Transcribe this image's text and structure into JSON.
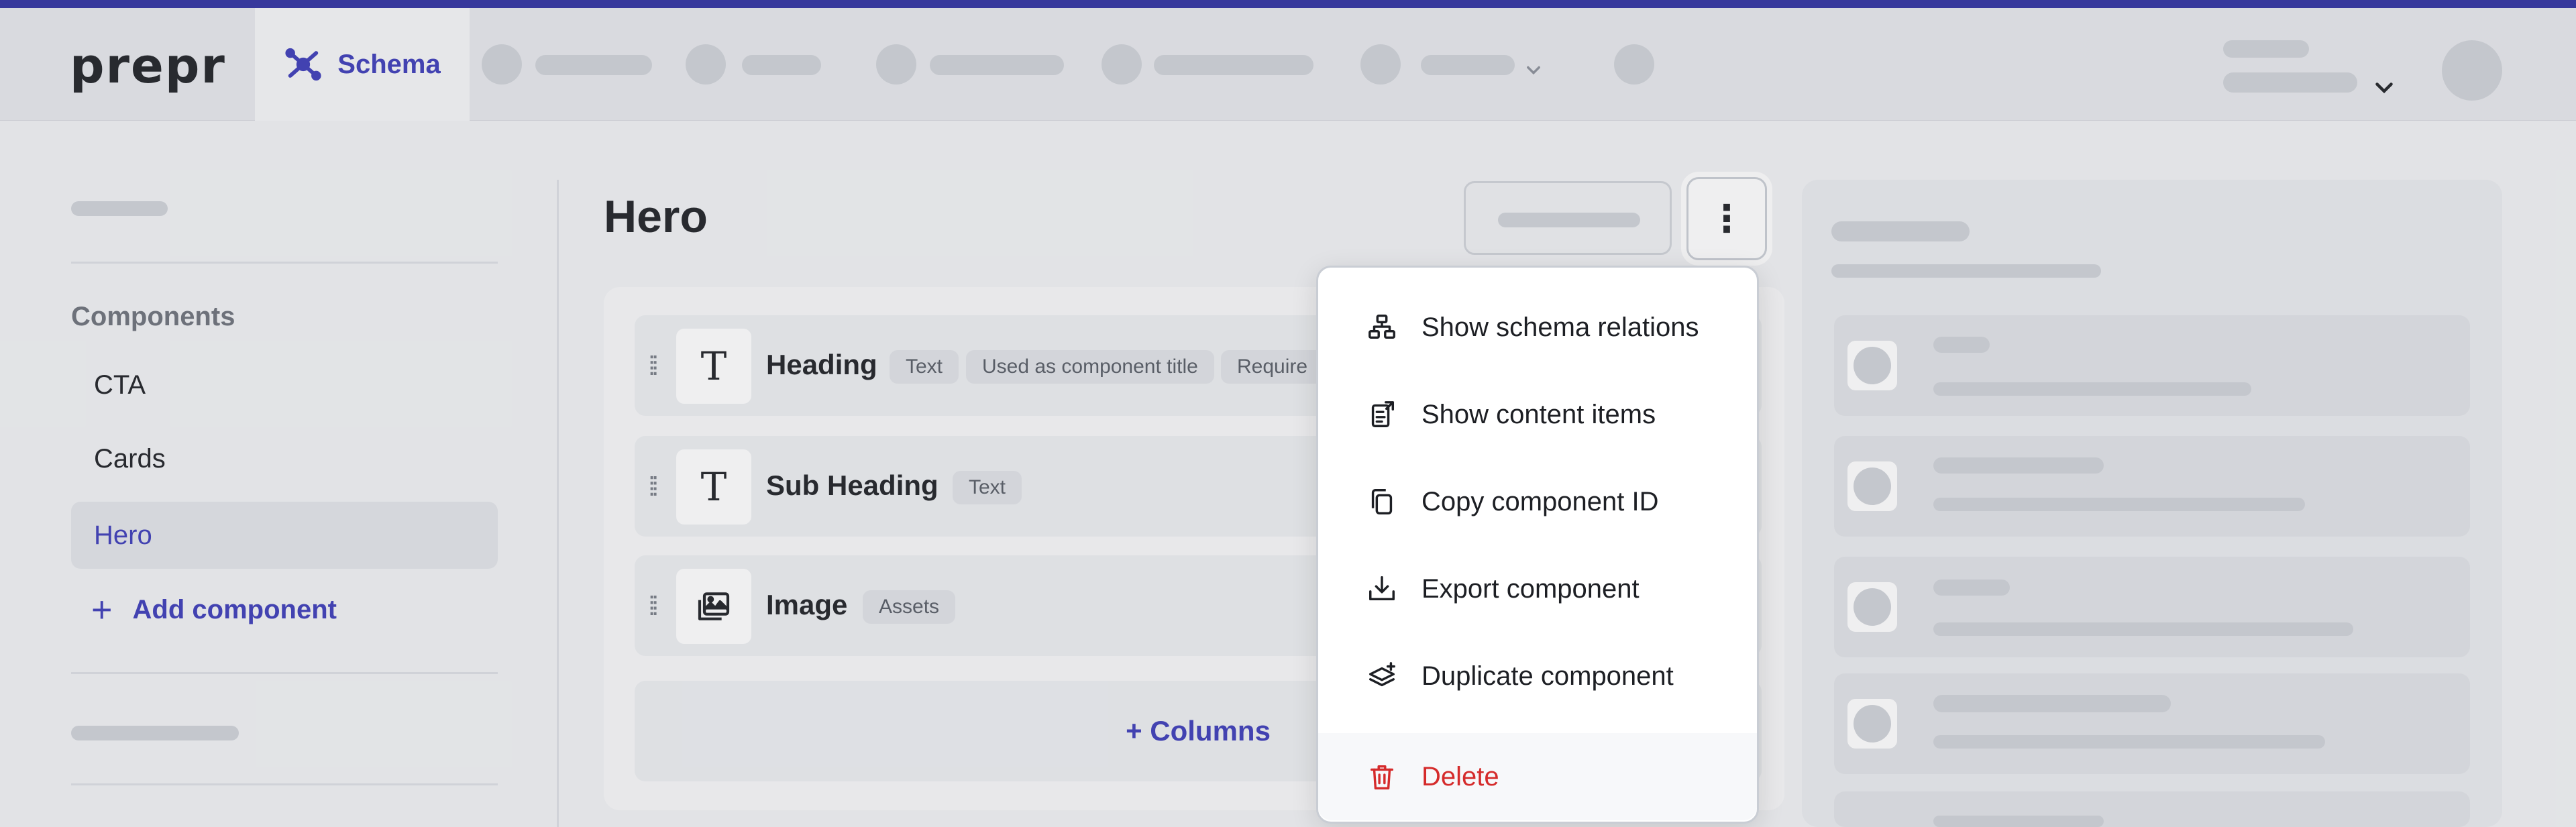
{
  "app": {
    "logo": "prepr",
    "active_tab": "Schema"
  },
  "sidebar": {
    "section_title": "Components",
    "items": [
      {
        "label": "CTA",
        "active": false
      },
      {
        "label": "Cards",
        "active": false
      },
      {
        "label": "Hero",
        "active": true
      }
    ],
    "add_label": "Add component"
  },
  "main": {
    "title": "Hero",
    "fields": [
      {
        "name": "Heading",
        "icon": "text-type-icon",
        "tags": [
          "Text",
          "Used as component title",
          "Require"
        ]
      },
      {
        "name": "Sub Heading",
        "icon": "text-type-icon",
        "tags": [
          "Text"
        ]
      },
      {
        "name": "Image",
        "icon": "assets-icon",
        "tags": [
          "Assets"
        ]
      }
    ],
    "add_columns_label": "+ Columns"
  },
  "menu": {
    "items": [
      {
        "label": "Show schema relations",
        "icon": "schema-relations-icon"
      },
      {
        "label": "Show content items",
        "icon": "content-items-icon"
      },
      {
        "label": "Copy component ID",
        "icon": "copy-icon"
      },
      {
        "label": "Export component",
        "icon": "export-icon"
      },
      {
        "label": "Duplicate component",
        "icon": "duplicate-icon"
      },
      {
        "label": "Delete",
        "icon": "trash-icon",
        "danger": true
      }
    ]
  },
  "colors": {
    "accent": "#3b3bb8",
    "top_accent": "#2e2fa0",
    "danger": "#d52b2b"
  }
}
